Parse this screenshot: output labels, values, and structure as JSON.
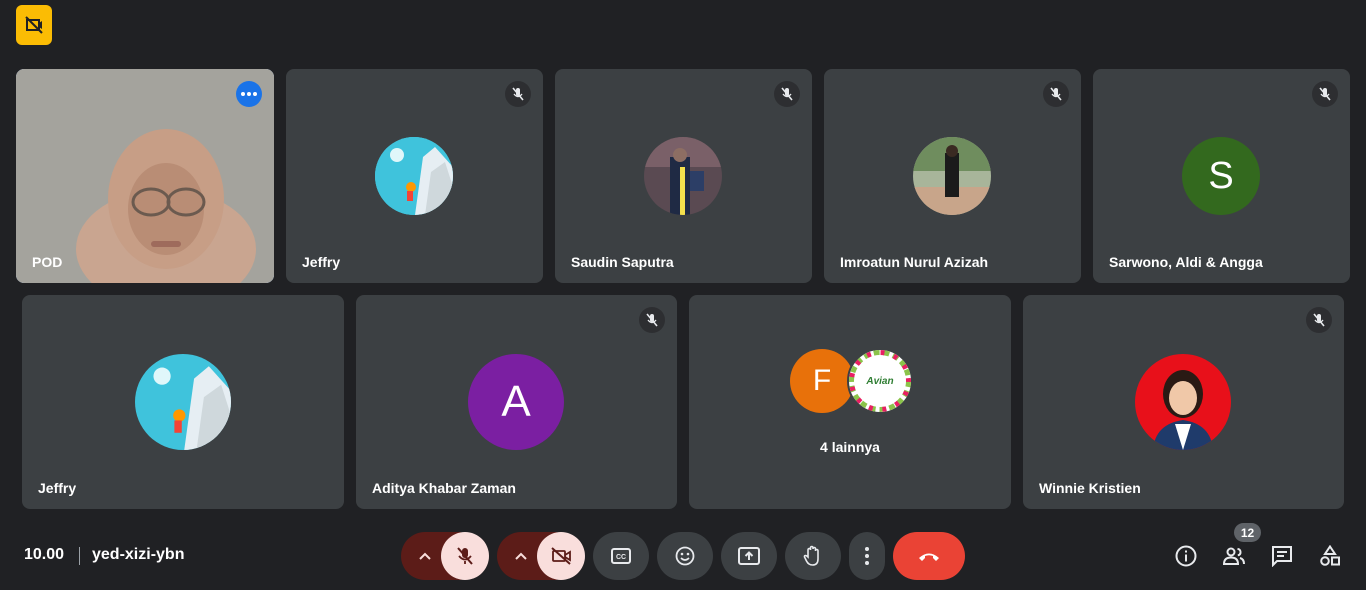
{
  "meeting": {
    "time": "10.00",
    "code": "yed-xizi-ybn"
  },
  "tiles_row1": [
    {
      "name": "POD"
    },
    {
      "name": "Jeffry"
    },
    {
      "name": "Saudin Saputra"
    },
    {
      "name": "Imroatun Nurul Azizah"
    },
    {
      "name": "Sarwono, Aldi & Angga",
      "initial": "S"
    }
  ],
  "tiles_row2": [
    {
      "name": "Jeffry"
    },
    {
      "name": "Aditya Khabar Zaman",
      "initial": "A"
    },
    {
      "name": "4 lainnya",
      "initial": "F",
      "logo_text": "Avian"
    },
    {
      "name": "Winnie Kristien"
    }
  ],
  "participants_count": "12",
  "icons": [
    "no-video-badge-icon",
    "mic-off-icon",
    "more-options-icon",
    "chevron-up-icon",
    "camera-off-icon",
    "captions-icon",
    "emoji-icon",
    "present-icon",
    "raise-hand-icon",
    "more-vert-icon",
    "end-call-icon",
    "info-icon",
    "people-icon",
    "chat-icon",
    "activities-icon"
  ],
  "colors": {
    "background": "#202124",
    "tile": "#3c4043",
    "active_outline": "#8ab4f8",
    "end_call": "#ea4335",
    "off_toggle": "#f9dedc",
    "badge": "#fbbc04",
    "avatar_s": "#33691e",
    "avatar_a": "#7b1fa2",
    "avatar_f": "#e8710a"
  }
}
